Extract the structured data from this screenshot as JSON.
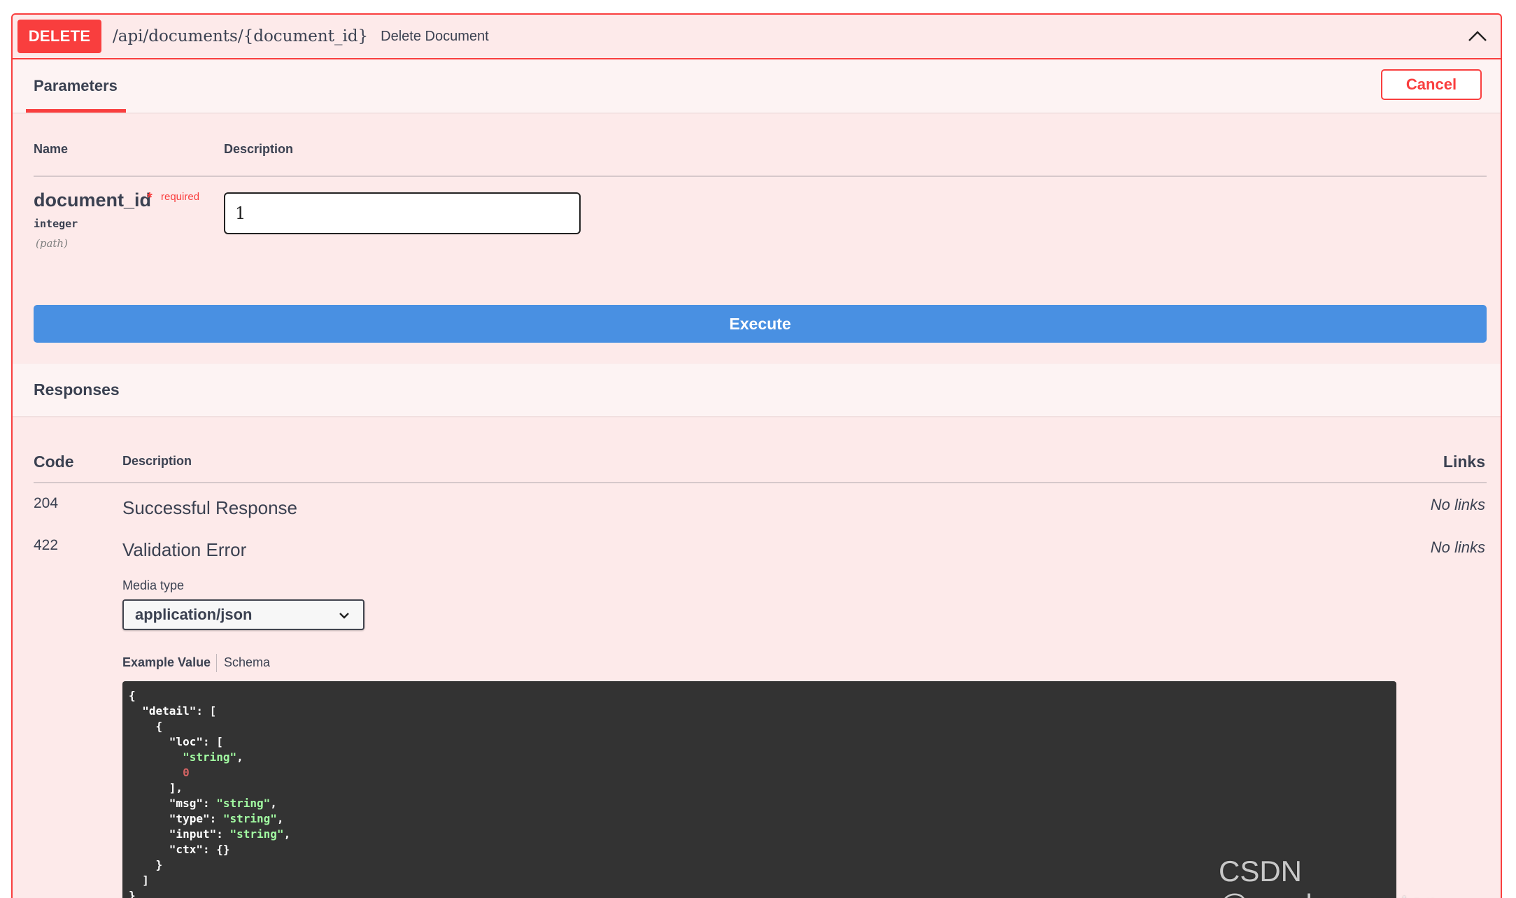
{
  "operation": {
    "method": "DELETE",
    "path": "/api/documents/{document_id}",
    "summary": "Delete Document"
  },
  "parameters_section": {
    "tab_label": "Parameters",
    "cancel_label": "Cancel",
    "col_name": "Name",
    "col_description": "Description",
    "params": [
      {
        "name": "document_id",
        "required_star": "*",
        "required_label": "required",
        "type": "integer",
        "location": "(path)",
        "value": "1"
      }
    ]
  },
  "execute_label": "Execute",
  "responses_section": {
    "title": "Responses",
    "col_code": "Code",
    "col_description": "Description",
    "col_links": "Links",
    "rows": [
      {
        "code": "204",
        "description": "Successful Response",
        "links": "No links"
      },
      {
        "code": "422",
        "description": "Validation Error",
        "links": "No links"
      }
    ],
    "media_type_label": "Media type",
    "media_type_selected": "application/json",
    "tabs": {
      "example": "Example Value",
      "schema": "Schema"
    }
  },
  "watermark": "CSDN @_codemonster",
  "colors": {
    "delete_red": "#f93e3e",
    "block_bg": "#fdeaea",
    "execute_blue": "#4990e2",
    "code_bg": "#333333",
    "json_string": "#a2fca2",
    "json_number": "#d36363"
  }
}
